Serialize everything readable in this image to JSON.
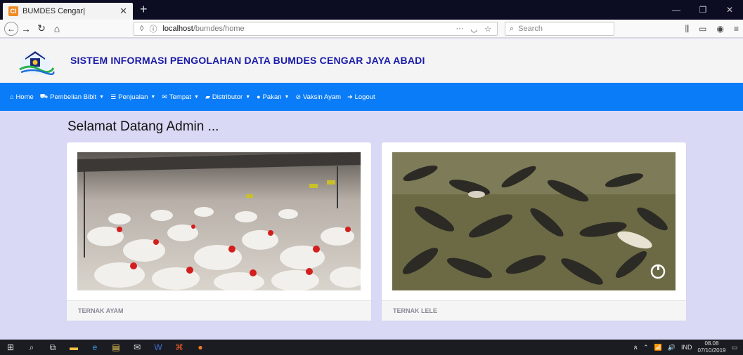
{
  "browser": {
    "tab_title": "BUMDES Cengar|",
    "tab_favicon": "CI",
    "url_host": "localhost",
    "url_path": "/bumdes/home",
    "search_placeholder": "Search"
  },
  "site": {
    "title": "SISTEM INFORMASI PENGOLAHAN DATA BUMDES CENGAR JAYA ABADI",
    "brand_color": "#0a7cf7",
    "title_color": "#1a1aa8"
  },
  "nav": {
    "items": [
      {
        "label": "Home",
        "icon": "home-icon",
        "dropdown": false
      },
      {
        "label": "Pembelian Bibit",
        "icon": "cart-icon",
        "dropdown": true
      },
      {
        "label": "Penjualan",
        "icon": "list-icon",
        "dropdown": true
      },
      {
        "label": "Tempat",
        "icon": "envelope-icon",
        "dropdown": true
      },
      {
        "label": "Distributor",
        "icon": "book-icon",
        "dropdown": true
      },
      {
        "label": "Pakan",
        "icon": "info-circle-icon",
        "dropdown": true
      },
      {
        "label": "Vaksin Ayam",
        "icon": "ban-icon",
        "dropdown": false
      },
      {
        "label": "Logout",
        "icon": "logout-icon",
        "dropdown": false
      }
    ]
  },
  "main": {
    "welcome": "Selamat Datang Admin ...",
    "cards": [
      {
        "label": "TERNAK AYAM",
        "image": "chicken-farm"
      },
      {
        "label": "TERNAK LELE",
        "image": "catfish-pond"
      }
    ]
  },
  "taskbar": {
    "language": "IND",
    "time": "08.08",
    "date": "07/10/2019"
  }
}
